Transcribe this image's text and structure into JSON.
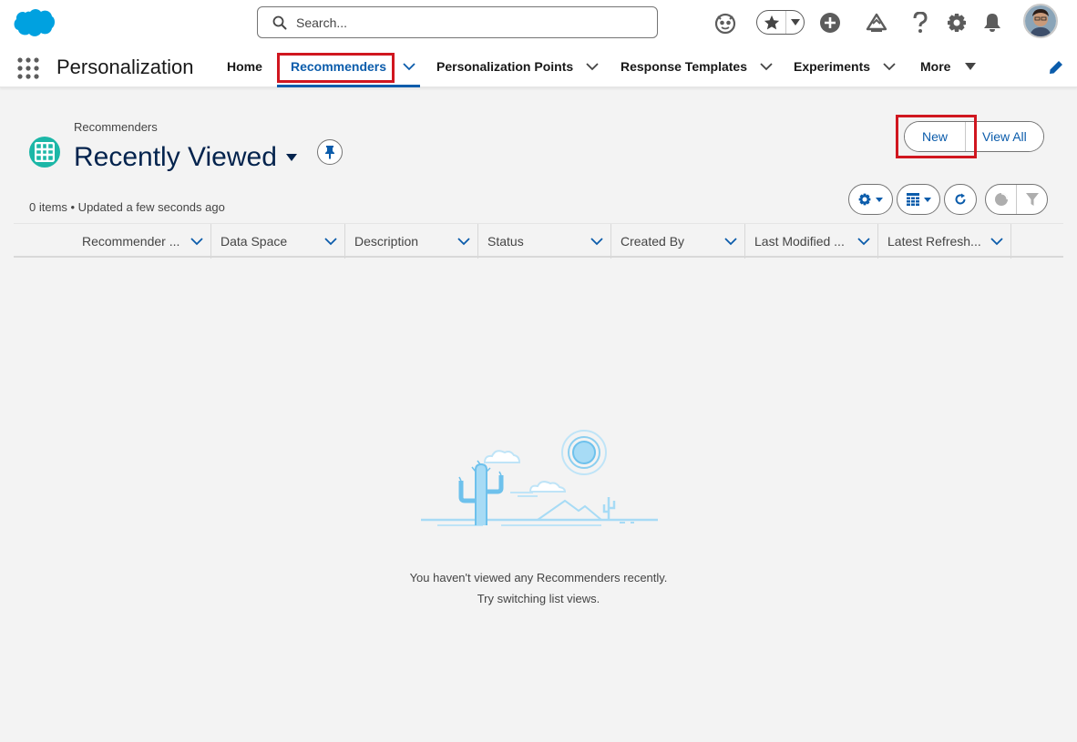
{
  "header": {
    "search_placeholder": "Search...",
    "brand_color": "#00a1e0"
  },
  "nav": {
    "app_name": "Personalization",
    "items": [
      {
        "label": "Home"
      },
      {
        "label": "Recommenders"
      },
      {
        "label": "Personalization Points"
      },
      {
        "label": "Response Templates"
      },
      {
        "label": "Experiments"
      },
      {
        "label": "More"
      }
    ],
    "active_index": 1,
    "active_color": "#0b5cab"
  },
  "list": {
    "object_label": "Recommenders",
    "title": "Recently Viewed",
    "new_label": "New",
    "view_all_label": "View All",
    "meta": "0 items • Updated a few seconds ago",
    "columns": [
      {
        "label": "Recommender ..."
      },
      {
        "label": "Data Space"
      },
      {
        "label": "Description"
      },
      {
        "label": "Status"
      },
      {
        "label": "Created By"
      },
      {
        "label": "Last Modified ..."
      },
      {
        "label": "Latest Refresh..."
      }
    ]
  },
  "empty_state": {
    "line1": "You haven't viewed any Recommenders recently.",
    "line2": "Try switching list views."
  },
  "icons": [
    "salesforce-logo",
    "search-icon",
    "einstein-icon",
    "star-icon",
    "plus-icon",
    "trailhead-icon",
    "help-icon",
    "gear-icon",
    "bell-icon",
    "app-launcher-icon",
    "pencil-icon",
    "grid-icon",
    "pin-icon",
    "refresh-icon",
    "chart-icon",
    "filter-icon",
    "table-icon"
  ]
}
